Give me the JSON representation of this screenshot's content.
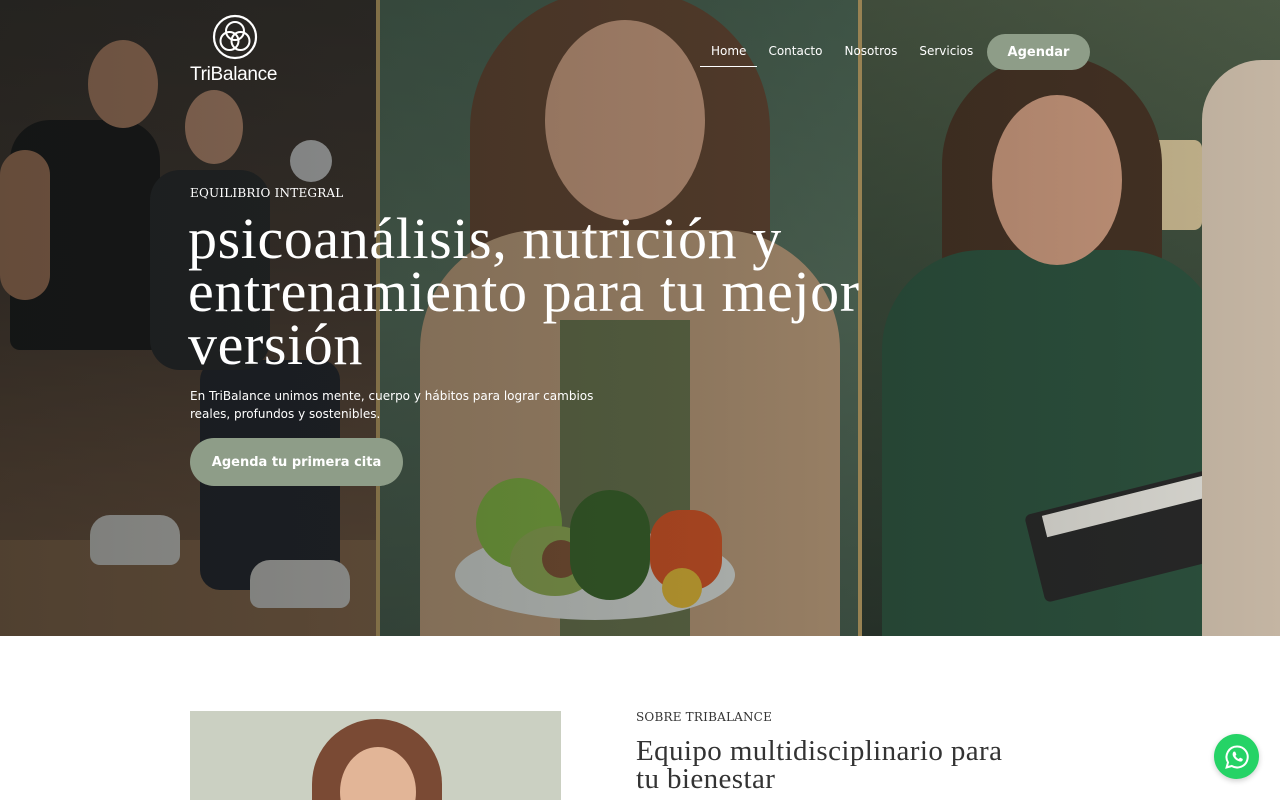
{
  "brand": {
    "name": "TriBalance",
    "icon": "triquetra-logo"
  },
  "nav": {
    "items": [
      {
        "label": "Home",
        "active": true
      },
      {
        "label": "Contacto"
      },
      {
        "label": "Nosotros"
      },
      {
        "label": "Servicios"
      }
    ],
    "cta_label": "Agendar"
  },
  "hero": {
    "eyebrow": "EQUILIBRIO INTEGRAL",
    "title": "psicoanálisis, nutrición y entrenamiento para tu mejor versión",
    "subtitle": "En TriBalance unimos mente, cuerpo y hábitos para lograr cambios reales, profundos y sostenibles.",
    "cta_label": "Agenda tu primera cita"
  },
  "about": {
    "eyebrow": "SOBRE TRIBALANCE",
    "title": "Equipo multidisciplinario para tu bienestar"
  },
  "floating": {
    "icon": "whatsapp-icon"
  },
  "colors": {
    "accent": "#8e9d88",
    "whatsapp": "#25d366",
    "divider": "#c7a86a"
  }
}
